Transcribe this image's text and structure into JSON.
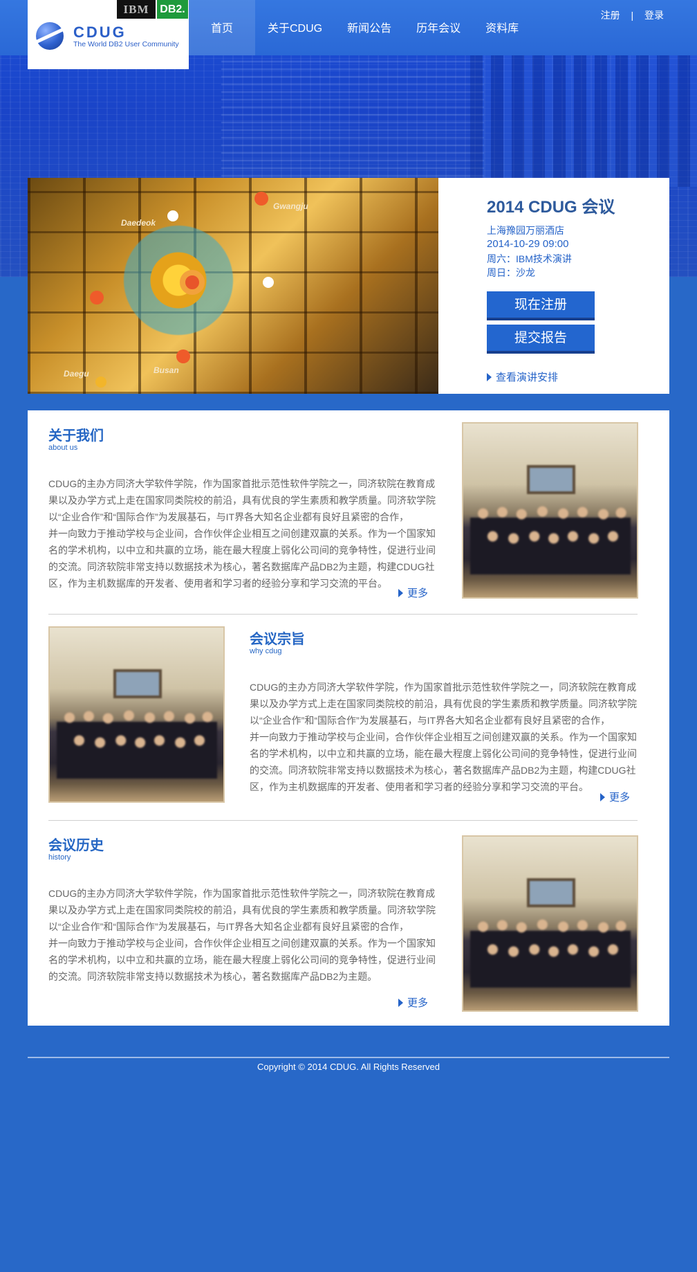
{
  "header": {
    "logo_title": "CDUG",
    "logo_subtitle": "The World DB2 User Community",
    "badge_ibm": "IBM",
    "badge_db2": "DB2.",
    "nav": [
      "首页",
      "关于CDUG",
      "新闻公告",
      "历年会议",
      "资料库"
    ],
    "register": "注册",
    "separator": "|",
    "login": "登录"
  },
  "hero": {
    "cities": [
      "Daedeok",
      "Gwangju",
      "Daegu",
      "Busan"
    ]
  },
  "conference": {
    "title": "2014 CDUG 会议",
    "venue": "上海豫园万丽酒店",
    "datetime": "2014-10-29 09:00",
    "saturday": "周六：IBM技术演讲",
    "sunday": "周日：沙龙",
    "register_button": "现在注册",
    "submit_button": "提交报告",
    "schedule_link": "查看演讲安排"
  },
  "sections": [
    {
      "title": "关于我们",
      "subtitle": "about us",
      "lines": [
        "CDUG的主办方同济大学软件学院，作为国家首批示范性软件学院之一，同济软院在教育成",
        "果以及办学方式上走在国家同类院校的前沿，具有优良的学生素质和教学质量。同济软学院",
        "以“企业合作”和“国际合作”为发展基石，与IT界各大知名企业都有良好且紧密的合作，",
        "并一向致力于推动学校与企业间，合作伙伴企业相互之间创建双赢的关系。作为一个国家知",
        "名的学术机构，以中立和共赢的立场，能在最大程度上弱化公司间的竞争特性，促进行业间",
        "的交流。同济软院非常支持以数据技术为核心，著名数据库产品DB2为主题，构建CDUG社",
        "区，作为主机数据库的开发者、使用者和学习者的经验分享和学习交流的平台。"
      ],
      "more": "更多"
    },
    {
      "title": "会议宗旨",
      "subtitle": "why cdug",
      "lines": [
        "CDUG的主办方同济大学软件学院，作为国家首批示范性软件学院之一，同济软院在教育成",
        "果以及办学方式上走在国家同类院校的前沿，具有优良的学生素质和教学质量。同济软学院",
        "以“企业合作”和“国际合作”为发展基石，与IT界各大知名企业都有良好且紧密的合作，",
        "并一向致力于推动学校与企业间，合作伙伴企业相互之间创建双赢的关系。作为一个国家知",
        "名的学术机构，以中立和共赢的立场，能在最大程度上弱化公司间的竞争特性，促进行业间",
        "的交流。同济软院非常支持以数据技术为核心，著名数据库产品DB2为主题，构建CDUG社",
        "区，作为主机数据库的开发者、使用者和学习者的经验分享和学习交流的平台。"
      ],
      "more": "更多"
    },
    {
      "title": "会议历史",
      "subtitle": "history",
      "lines": [
        "CDUG的主办方同济大学软件学院，作为国家首批示范性软件学院之一，同济软院在教育成",
        "果以及办学方式上走在国家同类院校的前沿，具有优良的学生素质和教学质量。同济软学院",
        "以“企业合作”和“国际合作”为发展基石，与IT界各大知名企业都有良好且紧密的合作，",
        "并一向致力于推动学校与企业间，合作伙伴企业相互之间创建双赢的关系。作为一个国家知",
        "名的学术机构，以中立和共赢的立场，能在最大程度上弱化公司间的竞争特性，促进行业间",
        "的交流。同济软院非常支持以数据技术为核心，著名数据库产品DB2为主题。"
      ],
      "more": "更多"
    }
  ],
  "footer": {
    "copyright": "Copyright © 2014 CDUG. All Rights Reserved"
  }
}
